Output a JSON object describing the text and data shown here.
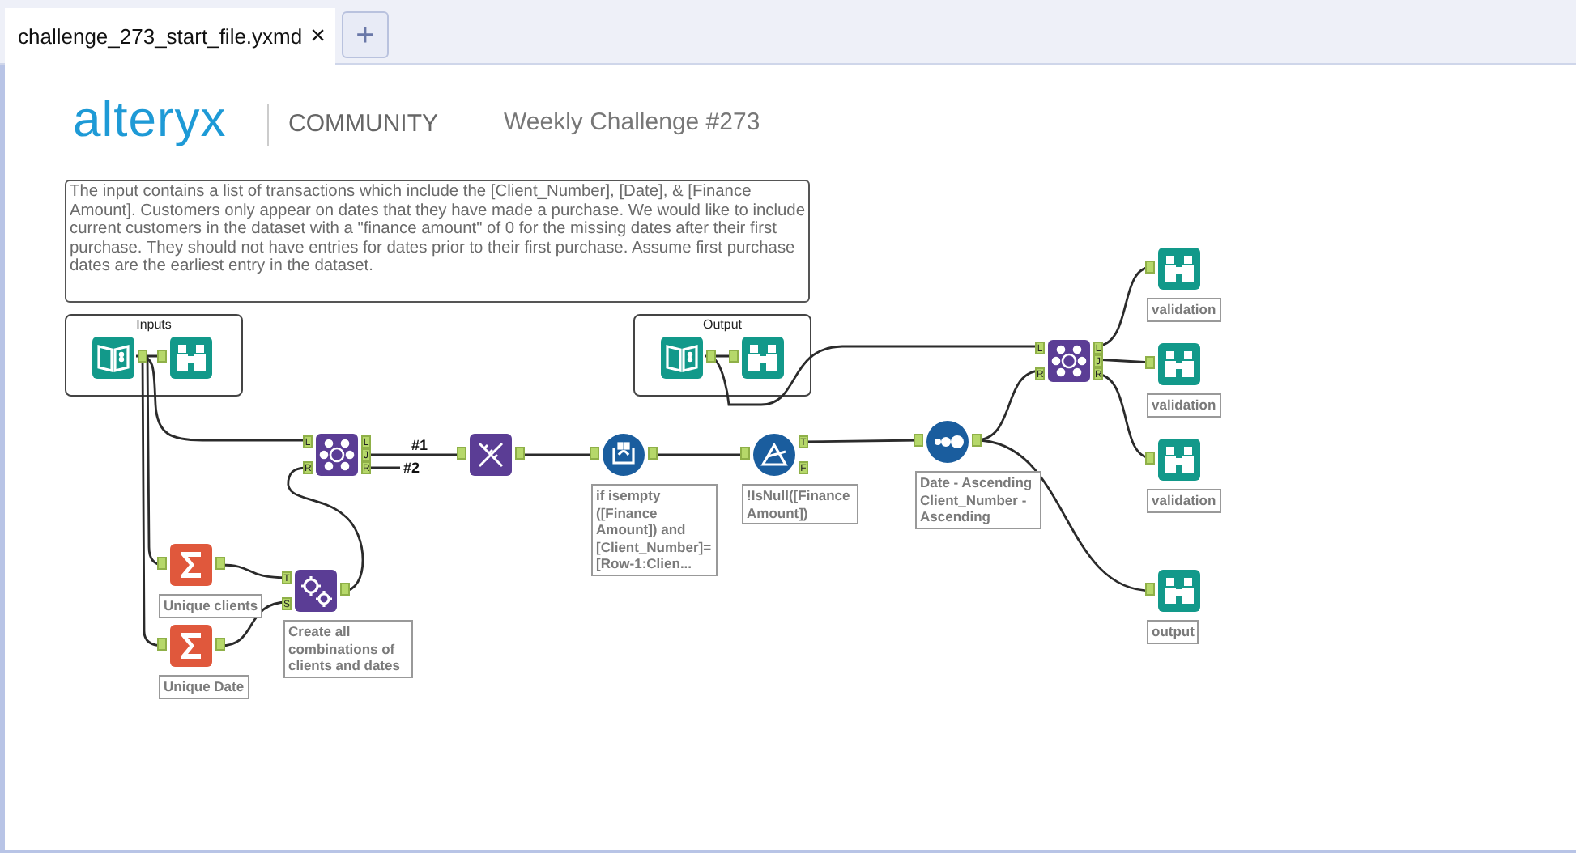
{
  "tabs": [
    {
      "label": "challenge_273_start_file.yxmd",
      "close": "×",
      "selected": true
    }
  ],
  "new_tab_button": "+",
  "header": {
    "logo": "alteryx",
    "brand": "COMMUNITY",
    "title": "Weekly Challenge #273"
  },
  "comment": "The input contains a list of transactions which include the [Client_Number], [Date], & [Finance Amount]. Customers only appear on dates that they have made a purchase. We would like to include current customers in the dataset with a \"finance amount\" of 0 for the missing dates after their first purchase. They should not have entries for dates prior to their first purchase. Assume first purchase dates are the earliest entry in the dataset.",
  "containers": [
    {
      "title": "Inputs"
    },
    {
      "title": "Output"
    }
  ],
  "tools": [
    {
      "kind": "input"
    },
    {
      "kind": "browse"
    },
    {
      "kind": "input"
    },
    {
      "kind": "browse"
    },
    {
      "kind": "join",
      "in_anchors": [
        "L",
        "R"
      ],
      "out_anchors": [
        "L",
        "J",
        "R"
      ]
    },
    {
      "kind": "select"
    },
    {
      "kind": "multirow",
      "label": "if isempty\n([Finance\nAmount]) and\n[Client_Number]=\n[Row-1:Clien..."
    },
    {
      "kind": "filter",
      "out_anchors": [
        "T",
        "F"
      ],
      "label": "!IsNull([Finance\nAmount])"
    },
    {
      "kind": "sort",
      "label": "Date - Ascending\nClient_Number -\nAscending"
    },
    {
      "kind": "join",
      "in_anchors": [
        "L",
        "R"
      ],
      "out_anchors": [
        "L",
        "J",
        "R"
      ]
    },
    {
      "kind": "browse",
      "label": "validation"
    },
    {
      "kind": "browse",
      "label": "validation"
    },
    {
      "kind": "browse",
      "label": "validation"
    },
    {
      "kind": "browse",
      "label": "output"
    },
    {
      "kind": "summarize",
      "label": "Unique clients"
    },
    {
      "kind": "summarize",
      "label": "Unique Date"
    },
    {
      "kind": "append",
      "in_anchors": [
        "T",
        "S"
      ],
      "label": "Create all\ncombinations of\nclients and dates"
    }
  ],
  "connection_labels": [
    "#1",
    "#2"
  ]
}
